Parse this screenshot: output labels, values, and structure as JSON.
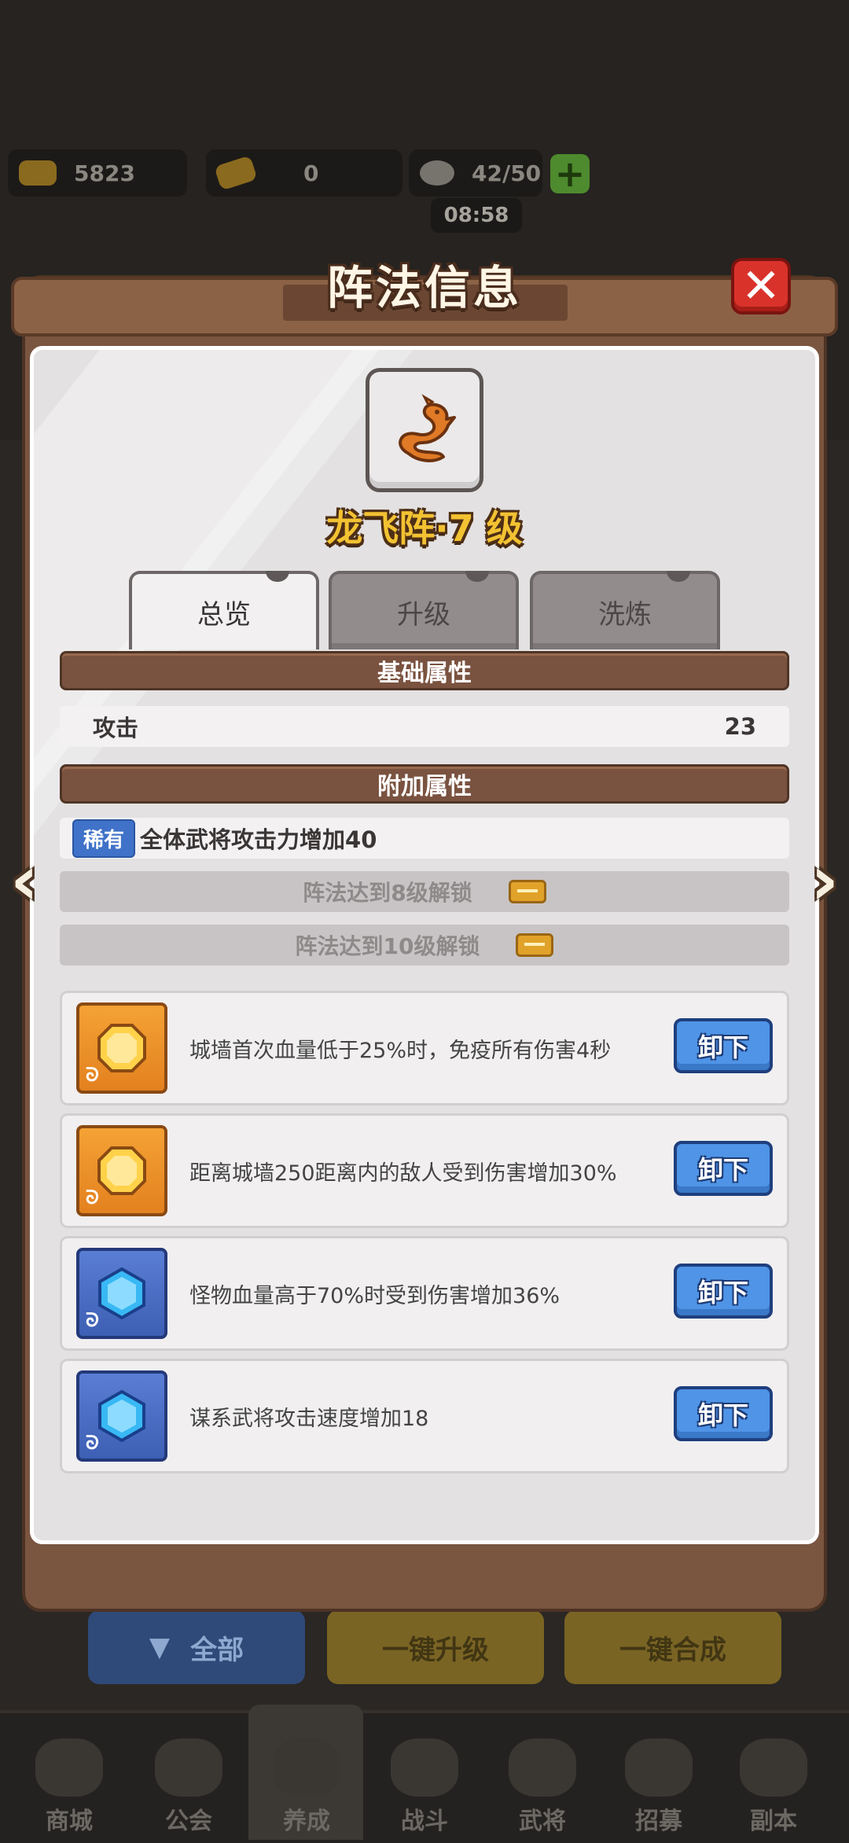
{
  "resources": {
    "gold": "5823",
    "ingot": "0",
    "stamina": "42/50",
    "timer": "08:58"
  },
  "modal": {
    "title": "阵法信息",
    "close_label": "✕"
  },
  "formation": {
    "name_level": "龙飞阵·7 级",
    "icon": "dragon-icon"
  },
  "tabs": [
    {
      "label": "总览",
      "active": true
    },
    {
      "label": "升级",
      "active": false
    },
    {
      "label": "洗炼",
      "active": false
    }
  ],
  "basic_attrs": {
    "title": "基础属性",
    "rows": [
      {
        "label": "攻击",
        "value": "23"
      }
    ]
  },
  "extra_attrs": {
    "title": "附加属性",
    "rare_badge": "稀有",
    "rare_text": "全体武将攻击力增加40",
    "locked": [
      "阵法达到8级解锁",
      "阵法达到10级解锁"
    ]
  },
  "gems": [
    {
      "color": "orange",
      "desc": "城墙首次血量低于25%时，免疫所有伤害4秒",
      "button": "卸下"
    },
    {
      "color": "orange",
      "desc": "距离城墙250距离内的敌人受到伤害增加30%",
      "button": "卸下"
    },
    {
      "color": "blue",
      "desc": "怪物血量高于70%时受到伤害增加36%",
      "button": "卸下"
    },
    {
      "color": "blue",
      "desc": "谋系武将攻击速度增加18",
      "button": "卸下"
    }
  ],
  "background_buttons": {
    "all": "全部",
    "upgrade_all": "一键升级",
    "merge_all": "一键合成"
  },
  "bottom_nav": [
    "商城",
    "公会",
    "养成",
    "战斗",
    "武将",
    "招募",
    "副本"
  ],
  "colors": {
    "section_brown": "#7a5240",
    "rare_blue": "#3f72c8",
    "unload_blue": "#4f94e6",
    "title_gold": "#f2c232",
    "close_red": "#d9322b"
  }
}
